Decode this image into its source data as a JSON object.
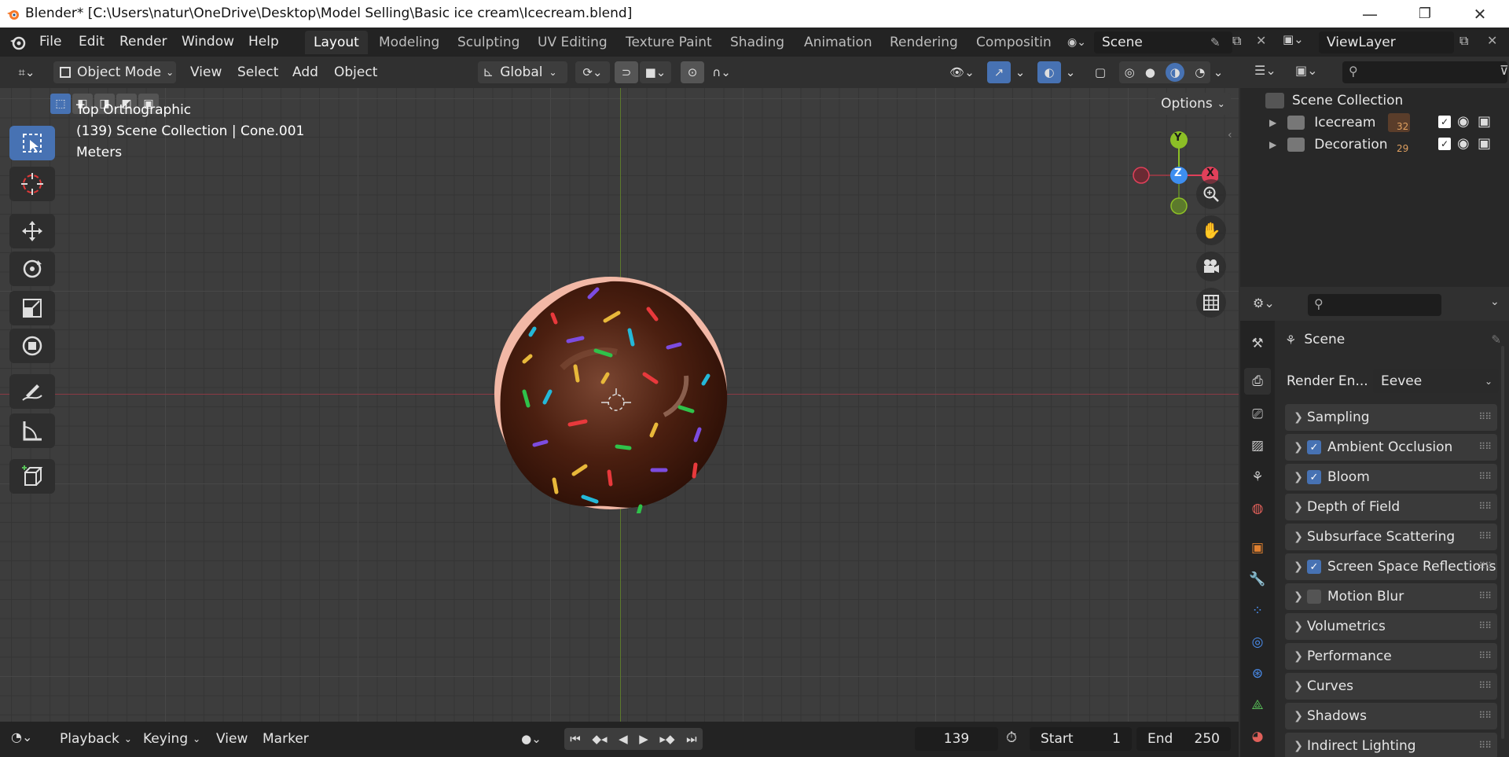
{
  "window": {
    "title": "Blender* [C:\\Users\\natur\\OneDrive\\Desktop\\Model Selling\\Basic ice cream\\Icecream.blend]",
    "minimize": "—",
    "restore": "❐",
    "close": "✕"
  },
  "menu": [
    "File",
    "Edit",
    "Render",
    "Window",
    "Help"
  ],
  "workspaces": [
    "Layout",
    "Modeling",
    "Sculpting",
    "UV Editing",
    "Texture Paint",
    "Shading",
    "Animation",
    "Rendering",
    "Compositin"
  ],
  "active_workspace": "Layout",
  "scene_field": "Scene",
  "viewlayer_field": "ViewLayer",
  "viewport_header": {
    "mode": "Object Mode",
    "menus": [
      "View",
      "Select",
      "Add",
      "Object"
    ],
    "transform_orientation": "Global",
    "options": "Options"
  },
  "viewport_overlay": {
    "view_name": "Top Orthographic",
    "collection_info": "(139) Scene Collection | Cone.001",
    "units": "Meters"
  },
  "gizmo": {
    "y": "Y",
    "z": "Z",
    "x": "X"
  },
  "colors": {
    "accent": "#4772b3",
    "x_axis": "#e0405a",
    "y_axis": "#8cbf26",
    "z_axis": "#3d8ef0",
    "chocolate": "#4b1f10",
    "dough": "#f2b8a6"
  },
  "outliner": {
    "root": "Scene Collection",
    "collections": [
      {
        "name": "Icecream",
        "count": "32"
      },
      {
        "name": "Decoration",
        "count": "29"
      }
    ]
  },
  "properties": {
    "context": "Scene",
    "render_engine_label": "Render En...",
    "render_engine_value": "Eevee",
    "panels": [
      {
        "label": "Sampling",
        "checkbox": null
      },
      {
        "label": "Ambient Occlusion",
        "checkbox": true
      },
      {
        "label": "Bloom",
        "checkbox": true
      },
      {
        "label": "Depth of Field",
        "checkbox": null
      },
      {
        "label": "Subsurface Scattering",
        "checkbox": null
      },
      {
        "label": "Screen Space Reflections",
        "checkbox": true
      },
      {
        "label": "Motion Blur",
        "checkbox": false
      },
      {
        "label": "Volumetrics",
        "checkbox": null
      },
      {
        "label": "Performance",
        "checkbox": null
      },
      {
        "label": "Curves",
        "checkbox": null
      },
      {
        "label": "Shadows",
        "checkbox": null
      },
      {
        "label": "Indirect Lighting",
        "checkbox": null
      }
    ]
  },
  "timeline": {
    "menus": [
      "Playback",
      "Keying",
      "View",
      "Marker"
    ],
    "current_frame": "139",
    "start_label": "Start",
    "start_value": "1",
    "end_label": "End",
    "end_value": "250"
  }
}
